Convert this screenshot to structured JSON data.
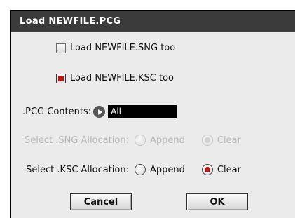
{
  "dialog": {
    "title": "Load NEWFILE.PCG"
  },
  "options": {
    "load_sng_label": "Load NEWFILE.SNG too",
    "load_sng_checked": false,
    "load_ksc_label": "Load NEWFILE.KSC too",
    "load_ksc_checked": true
  },
  "contents": {
    "label": ".PCG Contents:",
    "value": "All"
  },
  "sng_allocation": {
    "label": "Select .SNG Allocation:",
    "enabled": false,
    "append_label": "Append",
    "clear_label": "Clear",
    "selected": "Clear"
  },
  "ksc_allocation": {
    "label": "Select .KSC Allocation:",
    "enabled": true,
    "append_label": "Append",
    "clear_label": "Clear",
    "selected": "Clear"
  },
  "buttons": {
    "cancel": "Cancel",
    "ok": "OK"
  },
  "colors": {
    "accent_red": "#b21a16",
    "titlebar": "#3b3b3b",
    "dialog_bg": "#ebebeb"
  }
}
